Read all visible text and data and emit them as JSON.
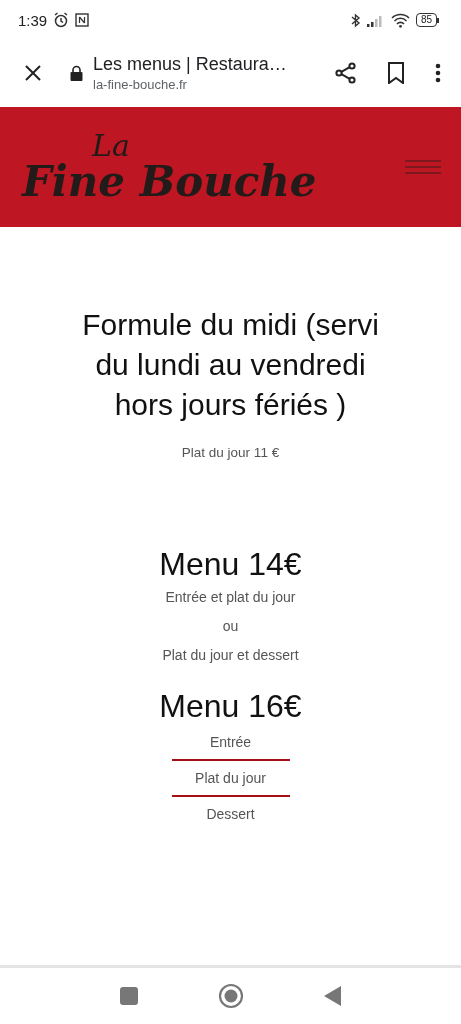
{
  "status_bar": {
    "time": "1:39",
    "battery": "85"
  },
  "browser": {
    "title": "Les menus | Restaura…",
    "url": "la-fine-bouche.fr"
  },
  "header": {
    "logo_top": "La",
    "logo_main": "Fine Bouche"
  },
  "formule": {
    "title": "Formule du midi (servi du lundi au vendredi hors jours fériés )",
    "price": "Plat du jour 11 €"
  },
  "menus": [
    {
      "title": "Menu 14€",
      "divided": false,
      "items": [
        "Entrée et plat du jour",
        "ou",
        "Plat du jour et dessert"
      ]
    },
    {
      "title": "Menu 16€",
      "divided": true,
      "items": [
        "Entrée",
        "Plat du jour",
        "Dessert"
      ]
    }
  ]
}
